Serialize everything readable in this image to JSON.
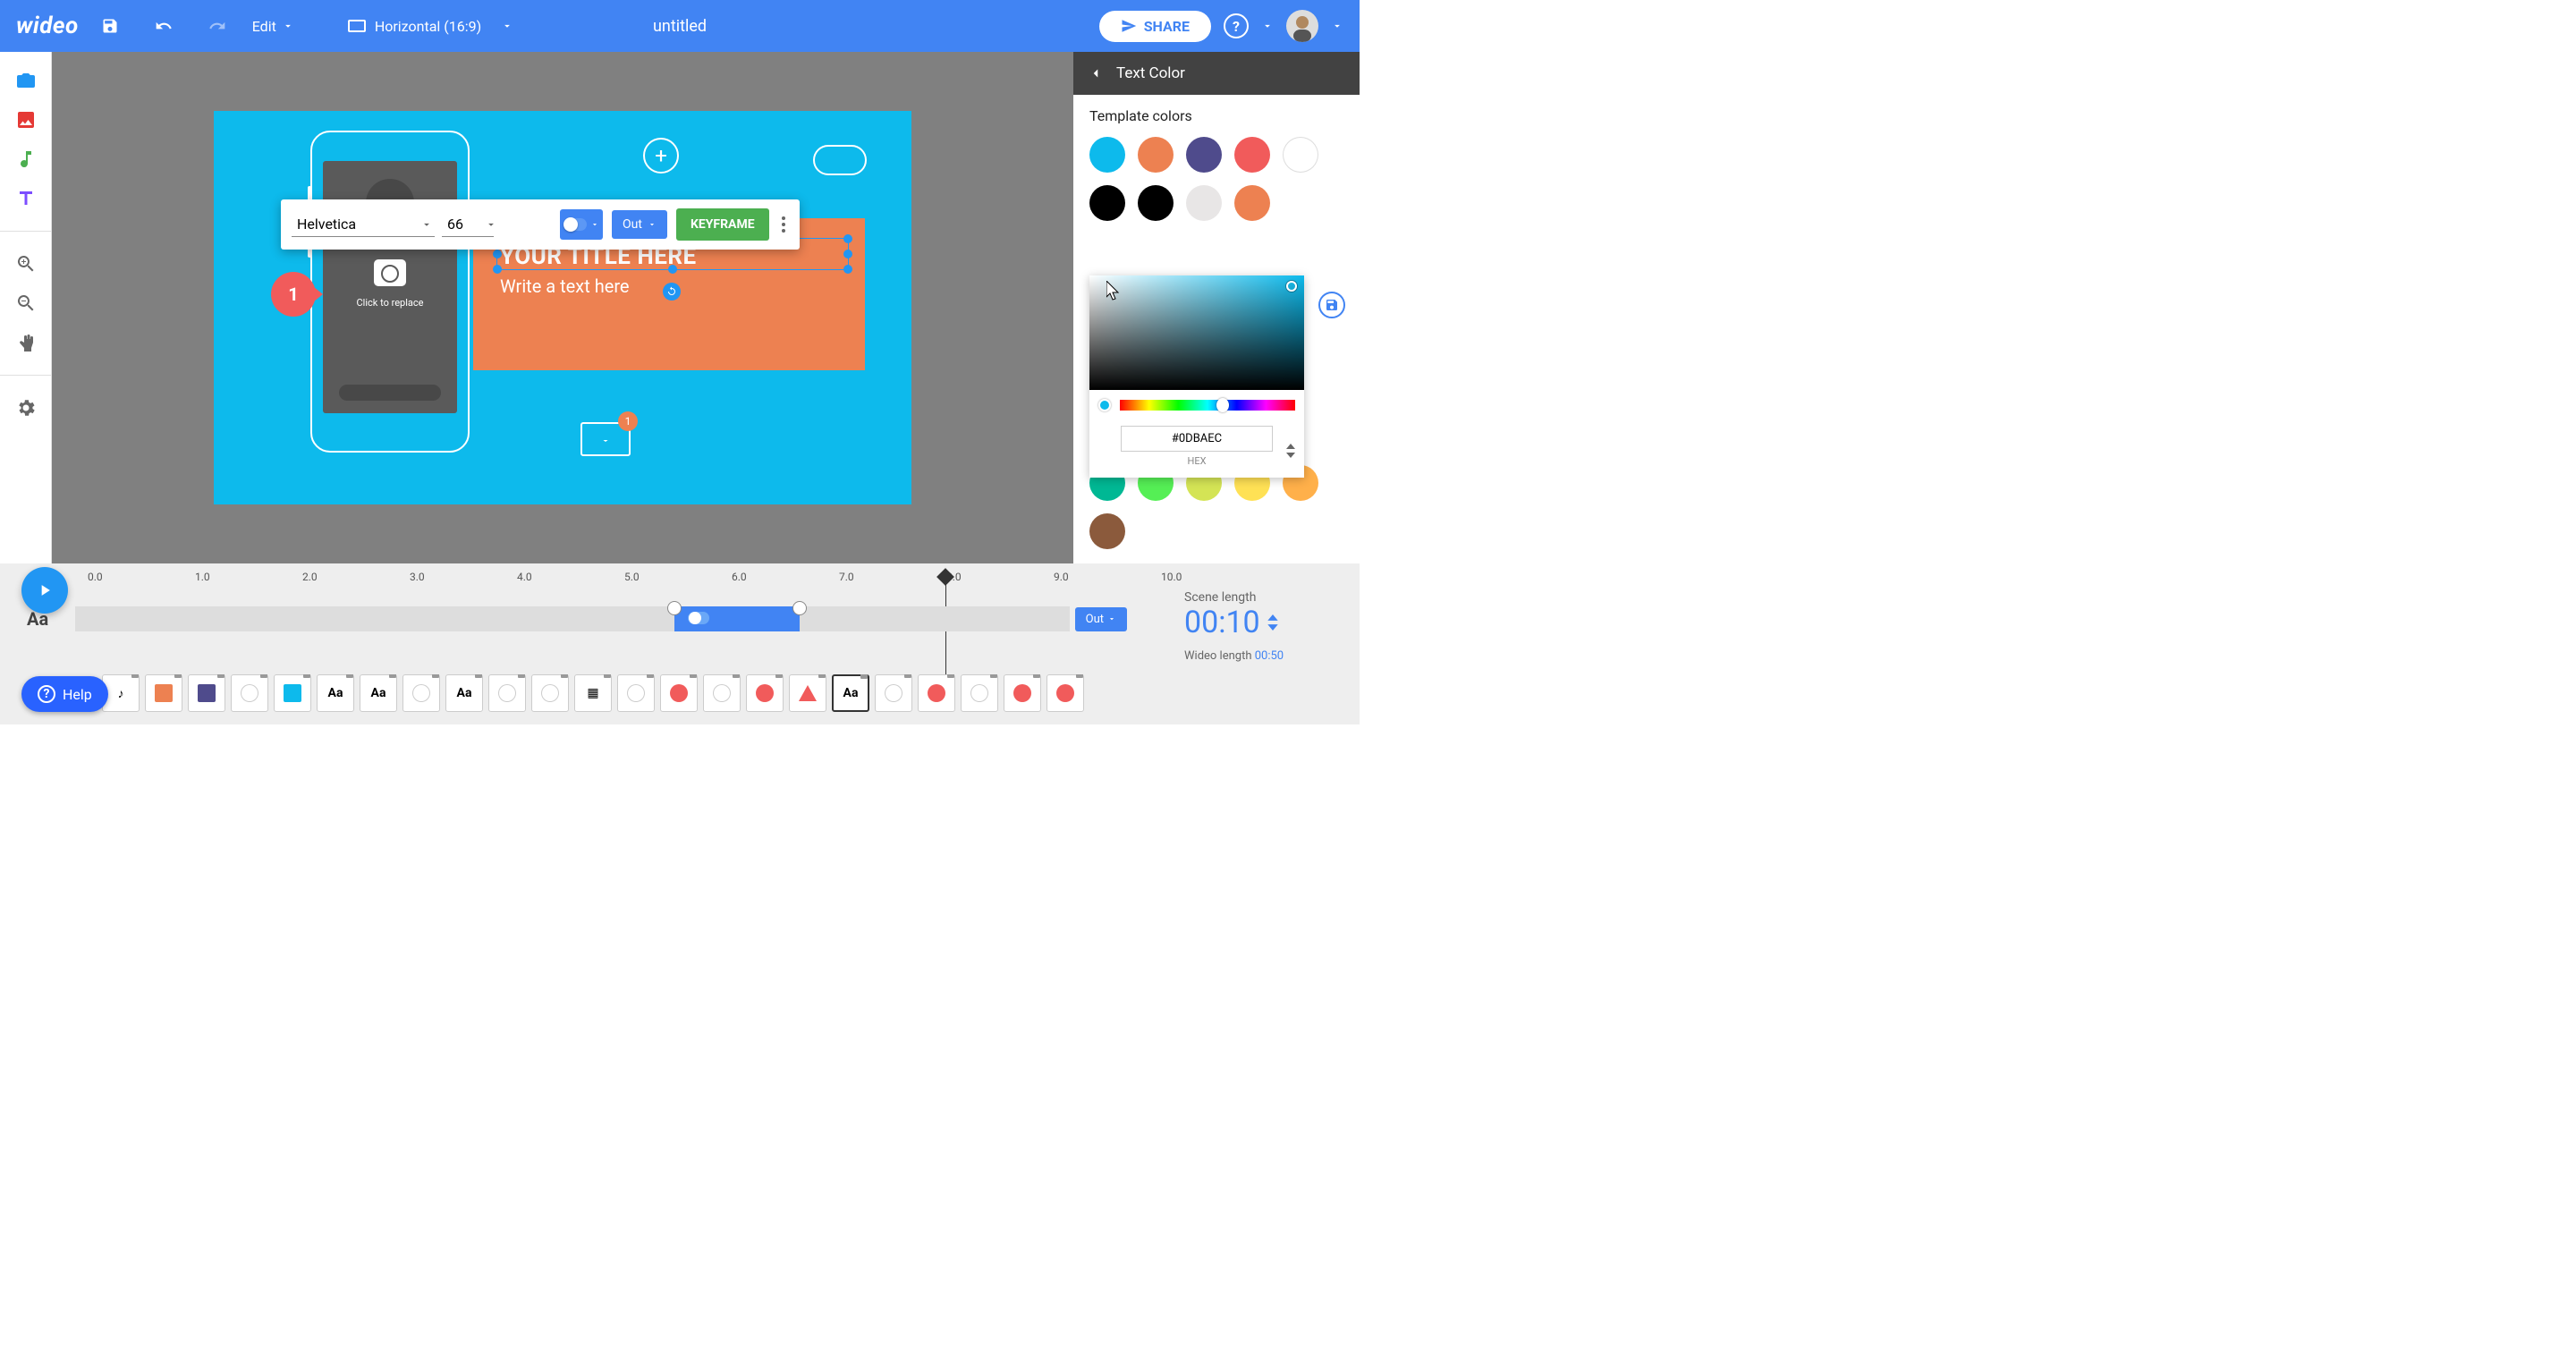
{
  "header": {
    "logo": "wideo",
    "edit_label": "Edit",
    "aspect_label": "Horizontal (16:9)",
    "title": "untitled",
    "share_label": "SHARE"
  },
  "canvas": {
    "title_text": "YOUR TITLE HERE",
    "subtitle_text": "Write a text here",
    "click_replace": "Click to replace",
    "badge1": "1",
    "env_badge": "1"
  },
  "float_toolbar": {
    "font": "Helvetica",
    "size": "66",
    "out_label": "Out",
    "keyframe_label": "KEYFRAME"
  },
  "right_panel": {
    "title": "Text Color",
    "template_label": "Template colors",
    "hex_value": "#0DBAEC",
    "hex_label": "HEX",
    "template_colors": [
      "#0DBAEC",
      "#ED8151",
      "#4F4B8C",
      "#F15B5B",
      "#FFFFFF",
      "#000000",
      "#000000",
      "#E8E6E6",
      "#ED8151"
    ],
    "flat_colors": [
      "#00B894",
      "#55EF55",
      "#D4E455",
      "#FFE155",
      "#FFB04A",
      "#8B5A3C"
    ]
  },
  "timeline": {
    "ruler": [
      "0.0",
      "1.0",
      "2.0",
      "3.0",
      "4.0",
      "5.0",
      "6.0",
      "7.0",
      "8.0",
      "9.0",
      "10.0"
    ],
    "track_label": "Aa",
    "out_label": "Out",
    "scene_label": "Scene length",
    "scene_time": "00:10",
    "wideo_label": "Wideo length ",
    "wideo_time": "00:50",
    "layers": [
      {
        "type": "music",
        "label": "♪"
      },
      {
        "type": "shape",
        "color": "#ED8151"
      },
      {
        "type": "shape",
        "color": "#4F4B8C"
      },
      {
        "type": "shape",
        "color": "#FFFFFF"
      },
      {
        "type": "shape",
        "color": "#0DBAEC"
      },
      {
        "type": "text",
        "label": "Aa"
      },
      {
        "type": "text",
        "label": "Aa"
      },
      {
        "type": "shape",
        "color": "#FFFFFF"
      },
      {
        "type": "text",
        "label": "Aa"
      },
      {
        "type": "shape",
        "color": "#FFFFFF"
      },
      {
        "type": "shape",
        "color": "#FFFFFF"
      },
      {
        "type": "image",
        "label": "▦"
      },
      {
        "type": "shape",
        "color": "#FFFFFF"
      },
      {
        "type": "shape",
        "color": "#F15B5B"
      },
      {
        "type": "shape",
        "color": "#FFFFFF"
      },
      {
        "type": "shape",
        "color": "#F15B5B"
      },
      {
        "type": "shape",
        "color": "#F15B5B",
        "tri": true
      },
      {
        "type": "text",
        "label": "Aa",
        "active": true
      },
      {
        "type": "shape",
        "color": "#FFFFFF"
      },
      {
        "type": "shape",
        "color": "#F15B5B"
      },
      {
        "type": "shape",
        "color": "#FFFFFF"
      },
      {
        "type": "shape",
        "color": "#F15B5B"
      },
      {
        "type": "shape",
        "color": "#F15B5B"
      }
    ]
  },
  "help_label": "Help"
}
